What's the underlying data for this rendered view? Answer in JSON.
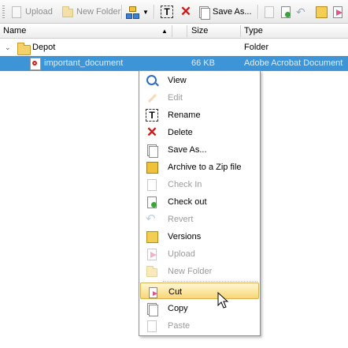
{
  "toolbar": {
    "upload_label": "Upload",
    "new_folder_label": "New Folder",
    "save_as_label": "Save As..."
  },
  "columns": {
    "name": "Name",
    "size": "Size",
    "type": "Type"
  },
  "rows": [
    {
      "name": "Depot",
      "size": "",
      "type": "Folder"
    },
    {
      "name": "important_document",
      "size": "66 KB",
      "type": "Adobe Acrobat Document"
    }
  ],
  "context_menu": {
    "items": [
      {
        "label": "View",
        "icon": "magnifier-icon",
        "enabled": true
      },
      {
        "label": "Edit",
        "icon": "pencil-icon",
        "enabled": false
      },
      {
        "label": "Rename",
        "icon": "rename-icon",
        "enabled": true
      },
      {
        "label": "Delete",
        "icon": "delete-icon",
        "enabled": true
      },
      {
        "label": "Save As...",
        "icon": "save-as-icon",
        "enabled": true
      },
      {
        "label": "Archive to a Zip file",
        "icon": "zip-icon",
        "enabled": true
      },
      {
        "label": "Check In",
        "icon": "check-in-icon",
        "enabled": false
      },
      {
        "label": "Check out",
        "icon": "check-out-icon",
        "enabled": true
      },
      {
        "label": "Revert",
        "icon": "revert-icon",
        "enabled": false
      },
      {
        "label": "Versions",
        "icon": "versions-icon",
        "enabled": true
      },
      {
        "label": "Upload",
        "icon": "upload-icon",
        "enabled": false
      },
      {
        "label": "New Folder",
        "icon": "new-folder-icon",
        "enabled": false
      },
      {
        "label": "Cut",
        "icon": "cut-icon",
        "enabled": true,
        "highlighted": true
      },
      {
        "label": "Copy",
        "icon": "copy-icon",
        "enabled": true
      },
      {
        "label": "Paste",
        "icon": "paste-icon",
        "enabled": false
      }
    ]
  },
  "colors": {
    "selection": "#3d95d7",
    "menu_highlight": "#f7d775",
    "delete_red": "#d01818"
  }
}
